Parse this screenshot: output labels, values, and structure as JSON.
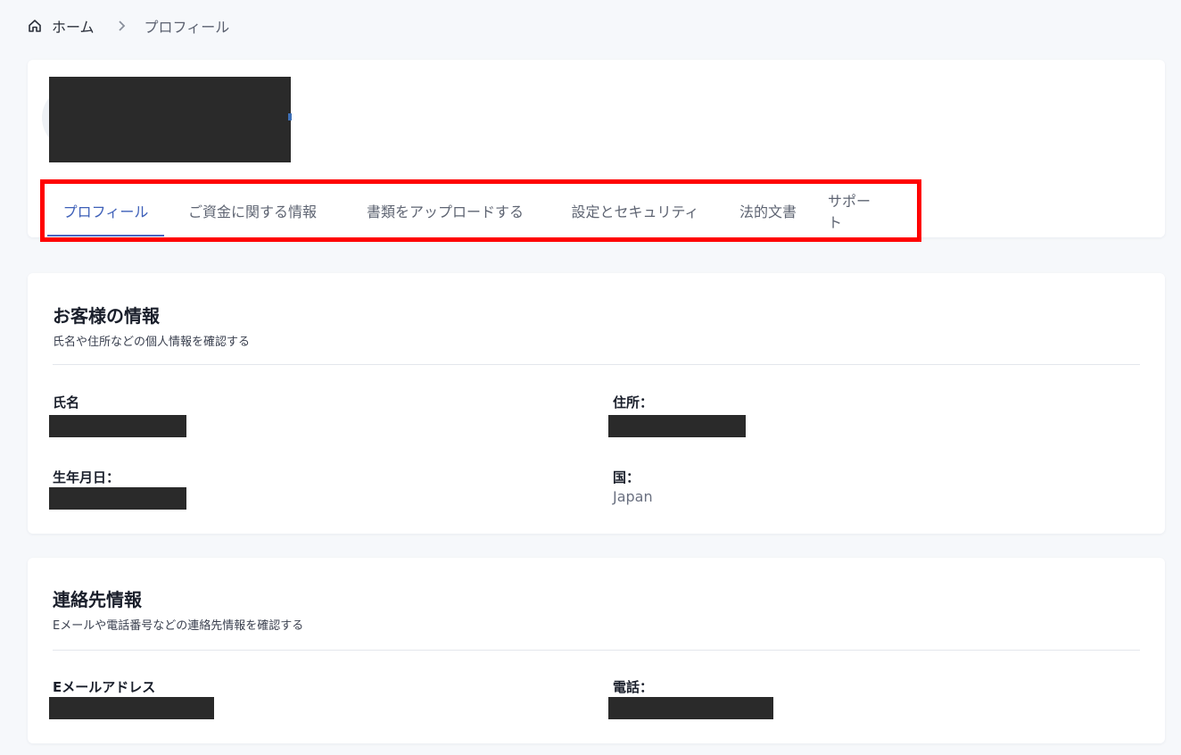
{
  "breadcrumb": {
    "home_label": "ホーム",
    "current_label": "プロフィール"
  },
  "tabs": [
    {
      "label": "プロフィール",
      "active": true
    },
    {
      "label": "ご資金に関する情報",
      "active": false
    },
    {
      "label": "書類をアップロードする",
      "active": false
    },
    {
      "label": "設定とセキュリティ",
      "active": false
    },
    {
      "label": "法的文書",
      "active": false
    },
    {
      "label": "サポート",
      "active": false
    }
  ],
  "customer_info": {
    "title": "お客様の情報",
    "subtitle": "氏名や住所などの個人情報を確認する",
    "name_label": "氏名",
    "address_label": "住所：",
    "birthdate_label": "生年月日：",
    "country_label": "国：",
    "country_value": "Japan"
  },
  "contact_info": {
    "title": "連絡先情報",
    "subtitle": "Eメールや電話番号などの連絡先情報を確認する",
    "email_label": "Eメールアドレス",
    "phone_label": "電話："
  },
  "colors": {
    "accent": "#4a66c4",
    "highlight_box": "#ff0000",
    "redaction": "#2a2a2a",
    "background": "#f6f8fb"
  }
}
